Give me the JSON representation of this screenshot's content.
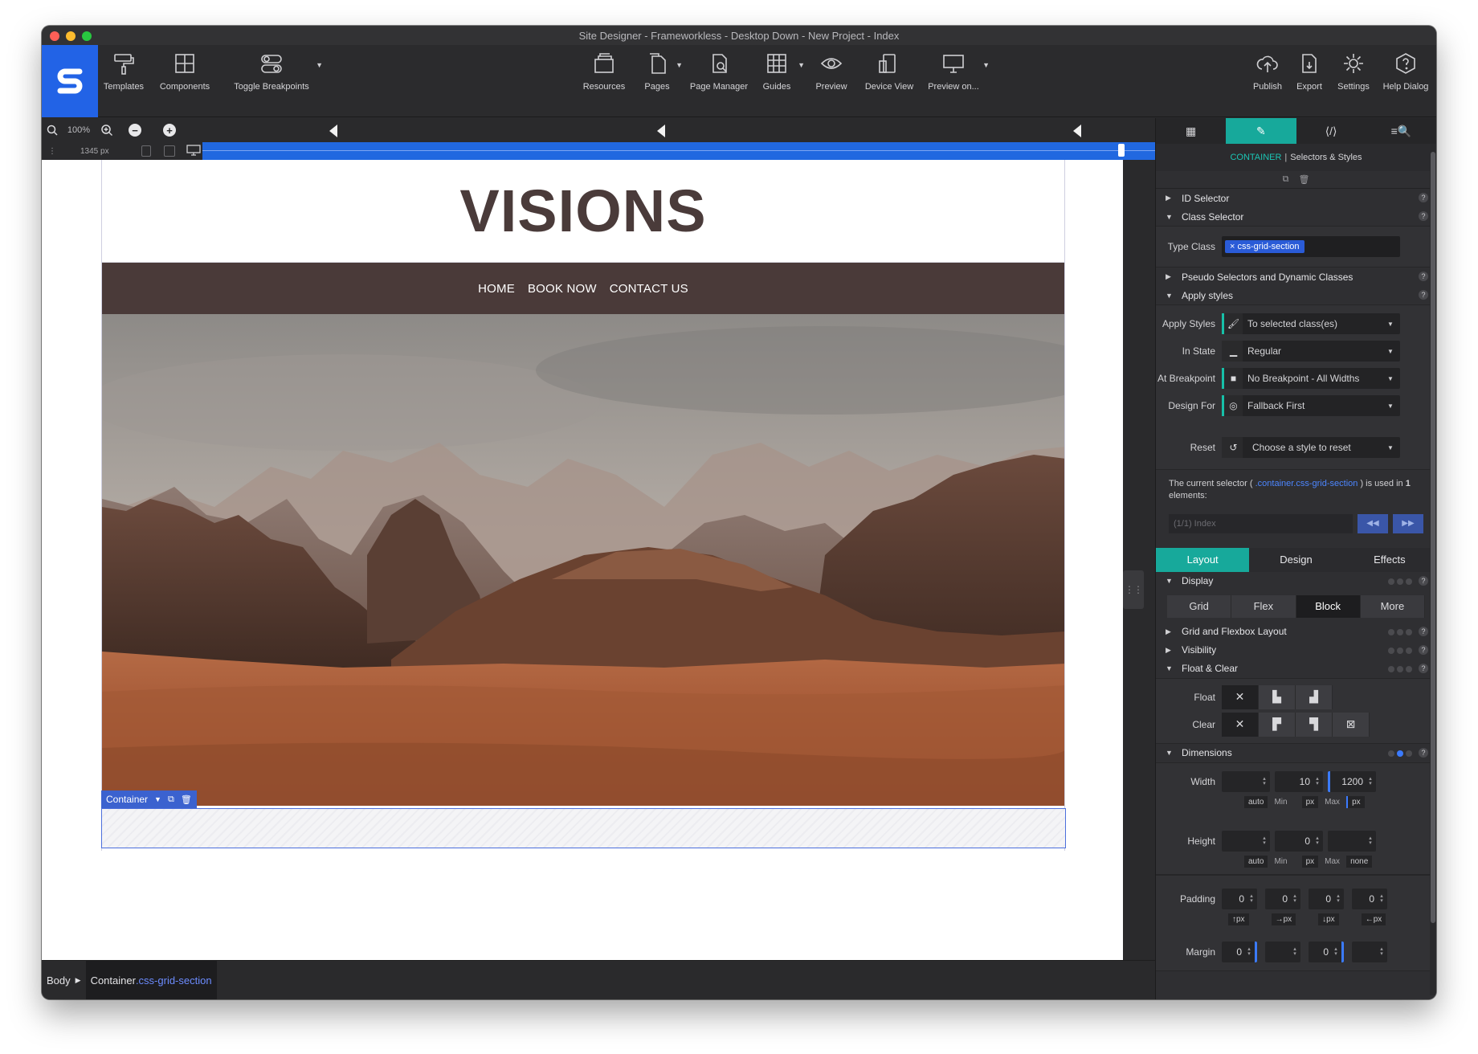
{
  "window": {
    "title": "Site Designer - Frameworkless - Desktop Down - New Project - Index"
  },
  "toolbar": {
    "left": [
      {
        "name": "templates",
        "label": "Templates",
        "icon": "paint-roller-icon"
      },
      {
        "name": "components",
        "label": "Components",
        "icon": "components-icon"
      },
      {
        "name": "toggle-breakpoints",
        "label": "Toggle Breakpoints",
        "icon": "toggle-icon"
      }
    ],
    "center": [
      {
        "name": "resources",
        "label": "Resources",
        "icon": "resources-icon"
      },
      {
        "name": "pages",
        "label": "Pages",
        "icon": "pages-icon"
      },
      {
        "name": "page-manager",
        "label": "Page Manager",
        "icon": "page-manager-icon"
      },
      {
        "name": "guides",
        "label": "Guides",
        "icon": "guides-icon"
      },
      {
        "name": "preview",
        "label": "Preview",
        "icon": "eye-icon"
      },
      {
        "name": "device-view",
        "label": "Device View",
        "icon": "device-icon"
      },
      {
        "name": "preview-on",
        "label": "Preview on...",
        "icon": "monitor-icon"
      }
    ],
    "right": [
      {
        "name": "publish",
        "label": "Publish",
        "icon": "cloud-upload-icon"
      },
      {
        "name": "export",
        "label": "Export",
        "icon": "export-icon"
      },
      {
        "name": "settings",
        "label": "Settings",
        "icon": "gear-icon"
      },
      {
        "name": "help-dialog",
        "label": "Help Dialog",
        "icon": "help-icon"
      }
    ]
  },
  "zoom": {
    "percent": "100%",
    "width_px": "1345 px"
  },
  "site": {
    "title": "VISIONS",
    "nav": [
      "HOME",
      "BOOK NOW",
      "CONTACT US"
    ]
  },
  "selection": {
    "label": "Container"
  },
  "breadcrumb": {
    "body": "Body",
    "element": "Container",
    "class": ".css-grid-section"
  },
  "panel": {
    "head": {
      "element": "CONTAINER",
      "title": "Selectors & Styles"
    },
    "sections": {
      "id_selector": "ID Selector",
      "class_selector": "Class Selector",
      "pseudo": "Pseudo Selectors and Dynamic Classes",
      "apply_styles": "Apply styles"
    },
    "type_class": {
      "label": "Type Class",
      "chip": "css-grid-section"
    },
    "apply": [
      {
        "label": "Apply Styles",
        "value": "To selected class(es)",
        "icon": "roller-icon"
      },
      {
        "label": "In State",
        "value": "Regular",
        "icon": "state-icon"
      },
      {
        "label": "At Breakpoint",
        "value": "No Breakpoint - All Widths",
        "icon": "breakpoint-icon"
      },
      {
        "label": "Design For",
        "value": "Fallback First",
        "icon": "target-icon"
      }
    ],
    "reset": {
      "label": "Reset",
      "value": "Choose a style to reset"
    },
    "info": {
      "prefix": "The current selector (",
      "selector": " .container.css-grid-section",
      "middle": " ) is used in ",
      "count": "1",
      "suffix": " elements:",
      "select_value": "(1/1) Index"
    },
    "design_tabs": [
      "Layout",
      "Design",
      "Effects"
    ],
    "display": {
      "title": "Display",
      "options": [
        "Grid",
        "Flex",
        "Block",
        "More"
      ],
      "selected": "Block"
    },
    "sub_sections": {
      "grid_flex": "Grid and Flexbox Layout",
      "visibility": "Visibility",
      "float_clear": "Float & Clear",
      "dimensions": "Dimensions"
    },
    "float": {
      "label": "Float"
    },
    "clear": {
      "label": "Clear"
    },
    "width": {
      "label": "Width",
      "min": "10",
      "max": "1200",
      "units": [
        "auto",
        "Min",
        "px",
        "Max",
        "px"
      ]
    },
    "height": {
      "label": "Height",
      "min": "0",
      "units": [
        "auto",
        "Min",
        "px",
        "Max",
        "none"
      ]
    },
    "padding": {
      "label": "Padding",
      "values": [
        "0",
        "0",
        "0",
        "0"
      ],
      "units": [
        "↑px",
        "→px",
        "↓px",
        "←px"
      ]
    },
    "margin": {
      "label": "Margin",
      "values": [
        "0",
        "0"
      ]
    }
  },
  "colors": {
    "accent_teal": "#17a99b",
    "brand_blue": "#2263e6",
    "nav_brown": "#4a3a39",
    "title_brown": "#4a3b3a"
  }
}
